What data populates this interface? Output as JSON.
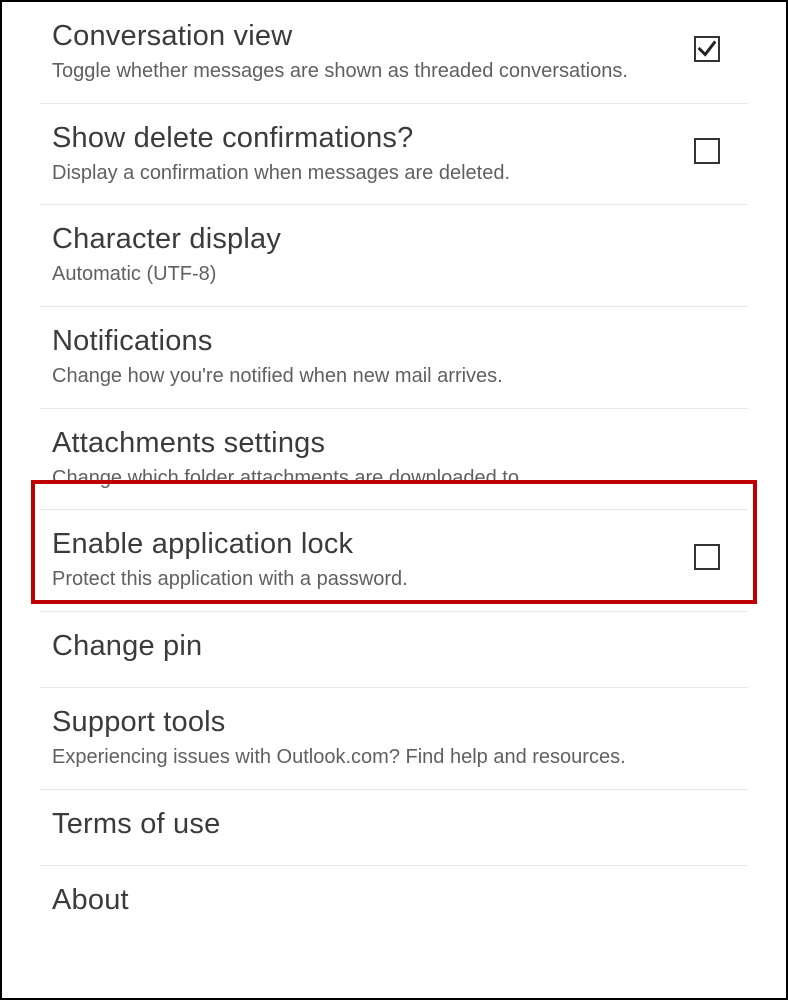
{
  "rows": [
    {
      "id": "conversation-view",
      "title": "Conversation view",
      "desc": "Toggle whether messages are shown as threaded conversations.",
      "checkbox": "checked"
    },
    {
      "id": "delete-confirm",
      "title": "Show delete confirmations?",
      "desc": "Display a confirmation when messages are deleted.",
      "checkbox": "unchecked"
    },
    {
      "id": "char-display",
      "title": "Character display",
      "desc": "Automatic (UTF-8)",
      "checkbox": "none"
    },
    {
      "id": "notifications",
      "title": "Notifications",
      "desc": "Change how you're notified when new mail arrives.",
      "checkbox": "none"
    },
    {
      "id": "attachments",
      "title": "Attachments settings",
      "desc": "Change which folder attachments are downloaded to.",
      "checkbox": "none"
    },
    {
      "id": "app-lock",
      "title": "Enable application lock",
      "desc": "Protect this application with a password.",
      "checkbox": "unchecked"
    },
    {
      "id": "change-pin",
      "title": "Change pin",
      "desc": "",
      "checkbox": "none"
    },
    {
      "id": "support",
      "title": "Support tools",
      "desc": "Experiencing issues with Outlook.com? Find help and resources.",
      "checkbox": "none"
    },
    {
      "id": "terms",
      "title": "Terms of use",
      "desc": "",
      "checkbox": "none"
    },
    {
      "id": "about",
      "title": "About",
      "desc": "",
      "checkbox": "none"
    }
  ],
  "highlight": {
    "rowId": "app-lock"
  }
}
